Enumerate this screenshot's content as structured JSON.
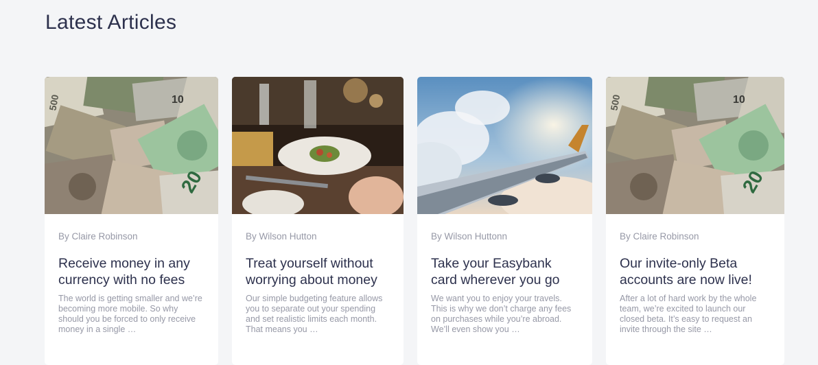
{
  "section": {
    "title": "Latest Articles"
  },
  "articles": [
    {
      "author": "By Claire Robinson",
      "title": "Receive money in any currency with no fees",
      "excerpt": "The world is getting smaller and we’re becoming more mobile. So why should you be forced to only receive money in a single …",
      "image": "currency-image"
    },
    {
      "author": "By Wilson Hutton",
      "title": "Treat yourself without worrying about money",
      "excerpt": "Our simple budgeting feature allows you to separate out your spending and set realistic limits each month. That means you …",
      "image": "restaurant-image"
    },
    {
      "author": "By Wilson Huttonn",
      "title": "Take your Easybank card wherever you go",
      "excerpt": "We want you to enjoy your travels. This is why we don’t charge any fees on purchases while you’re abroad. We’ll even show you …",
      "image": "plane-image"
    },
    {
      "author": "By Claire Robinson",
      "title": "Our invite-only Beta accounts are now live!",
      "excerpt": "After a lot of hard work by the whole team, we’re excited to launch our closed beta. It’s easy to request an invite through the site …",
      "image": "currency-image"
    }
  ],
  "banknote_labels": {
    "ten": "10",
    "twenty": "20",
    "five_hundred": "500"
  },
  "colors": {
    "title": "#2d314d",
    "body_text": "#9698a6",
    "background": "#f4f5f7",
    "card": "#ffffff"
  }
}
